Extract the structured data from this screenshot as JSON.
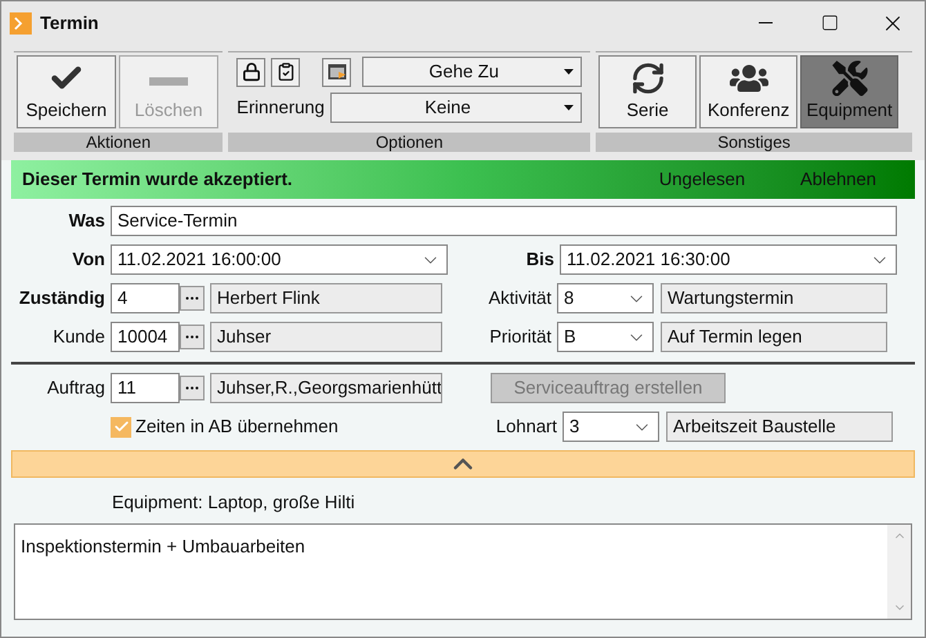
{
  "window": {
    "title": "Termin"
  },
  "ribbon": {
    "actions": {
      "label": "Aktionen",
      "buttons": [
        {
          "label": "Speichern",
          "disabled": false
        },
        {
          "label": "Löschen",
          "disabled": true
        }
      ]
    },
    "options": {
      "label": "Optionen",
      "goto": "Gehe Zu",
      "reminder_label": "Erinnerung",
      "reminder": "Keine"
    },
    "other": {
      "label": "Sonstiges",
      "buttons": [
        {
          "label": "Serie",
          "selected": false
        },
        {
          "label": "Konferenz",
          "selected": false
        },
        {
          "label": "Equipment",
          "selected": true
        }
      ]
    }
  },
  "banner": {
    "message": "Dieser Termin wurde akzeptiert.",
    "actions": [
      "Ungelesen",
      "Ablehnen"
    ]
  },
  "form": {
    "was": {
      "label": "Was",
      "value": "Service-Termin"
    },
    "von": {
      "label": "Von",
      "value": "11.02.2021 16:00:00"
    },
    "bis": {
      "label": "Bis",
      "value": "11.02.2021 16:30:00"
    },
    "zustaendig": {
      "label": "Zuständig",
      "code": "4",
      "name": "Herbert Flink"
    },
    "kunde": {
      "label": "Kunde",
      "code": "10004",
      "name": "Juhser"
    },
    "aktivitaet": {
      "label": "Aktivität",
      "code": "8",
      "name": "Wartungstermin"
    },
    "prioritaet": {
      "label": "Priorität",
      "code": "B",
      "name": "Auf Termin legen"
    },
    "auftrag": {
      "label": "Auftrag",
      "code": "11",
      "name": "Juhser,R.,Georgsmarienhütt"
    },
    "service_button": {
      "label": "Serviceauftrag erstellen",
      "disabled": true
    },
    "zeiten": {
      "label": "Zeiten in AB übernehmen",
      "checked": true
    },
    "lohnart": {
      "label": "Lohnart",
      "code": "3",
      "name": "Arbeitszeit Baustelle"
    }
  },
  "equipment_note": "Equipment: Laptop, große Hilti",
  "notes": "Inspektionstermin + Umbauarbeiten"
}
